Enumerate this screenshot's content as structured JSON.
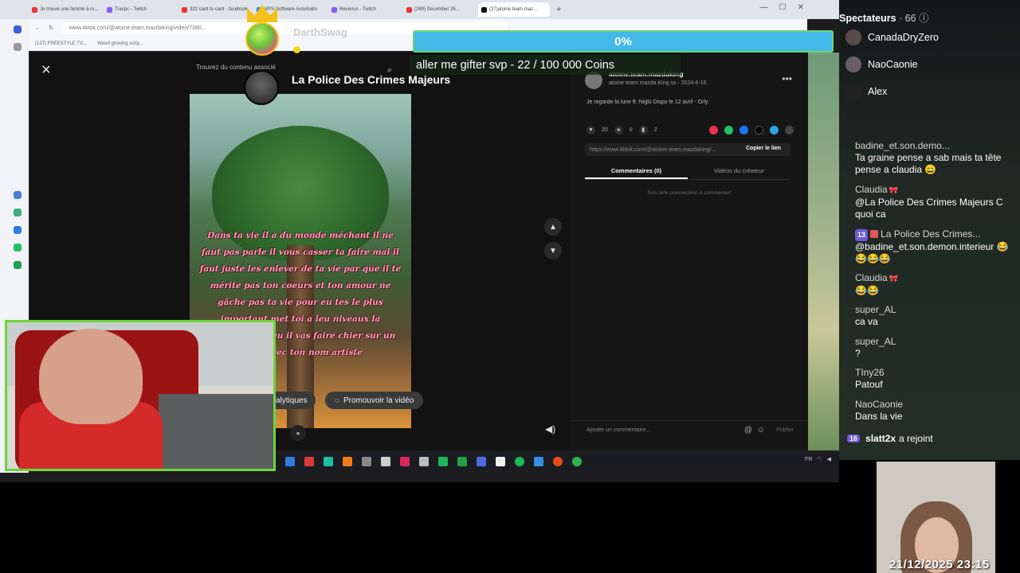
{
  "browser": {
    "tabs": [
      {
        "label": "Je trouve une femme à m..."
      },
      {
        "label": "Tracpc - Twitch"
      },
      {
        "label": "322 card to card - facebook"
      },
      {
        "label": "VPS-Software Automatio"
      },
      {
        "label": "Revenus - Twitch"
      },
      {
        "label": "(269) December 25..."
      },
      {
        "label": "(37)atoine.team.maz..."
      }
    ],
    "new_tab": "+",
    "url": "www.tiktok.com/@atoine.team.mazdaking/video/7380...",
    "bookmarks": [
      "(127) FREESTYLE TV...",
      "Weed growing scrip..."
    ]
  },
  "tiktok": {
    "close_icon": "×",
    "search_overlay": "Trouvez du contenu associé",
    "creator_name": "La Police Des Crimes Majeurs",
    "poem": "Dans ta vie il a du monde méchant il ne faut pas parle il vous casser ta faire mal il faut juste les enlever de ta vie par que il te mérite pas ton coeurs et ton amour ne gâche pas ta vie pour eu tes le plus important met toi a leu niveaux la personne que eu il vas faire chier sur un autre avec ton nom artiste",
    "analytics_label": "alytiques",
    "promote_label": "Promouvoir la vidéo",
    "author": {
      "name": "atoine.team.mazdaking",
      "sub": "atoine team mazda King ss · 2024-6-16"
    },
    "music": "Je regarde la lune ft. Niglo Dispo le 12 avril - Orly",
    "stats": {
      "likes": "20",
      "comments": "0",
      "saves": "2"
    },
    "link": "https://www.tiktok.com/@atoine.team.mazdaking/...",
    "copy_link": "Copier le lien",
    "tabs": [
      "Commentaires (0)",
      "Vidéos du créateur"
    ],
    "empty_comments": "Sois la/le premier(ère) à commenter!",
    "comment_placeholder": "Ajouter un commentaire...",
    "comment_at": "@",
    "comment_emoji": "☺",
    "post_label": "Publier"
  },
  "overlay": {
    "goal_percent": "0%",
    "goal_text": "aller me gifter svp - 22 / 100 000 Coins",
    "alert_user": "DarthSwag"
  },
  "chat": {
    "viewers_label": "Spectateurs",
    "viewers_count": "· 66",
    "viewers": [
      {
        "name": "CanadaDryZero"
      },
      {
        "name": "NaoCaonie"
      },
      {
        "name": "Alex"
      }
    ],
    "messages": [
      {
        "user": "badine_et.son.demo...",
        "text": "Ta graine pense a sab mais ta tête pense a claudia 😄"
      },
      {
        "user": "Claudia",
        "text": "@La Police Des Crimes Majeurs C quoi ca"
      },
      {
        "user": "La Police Des Crimes...",
        "badge": "13",
        "text": "@badine_et.son.demon.interieur 😂😂😂😂"
      },
      {
        "user": "Claudia",
        "text": "😂😂"
      },
      {
        "user": "super_AL",
        "text": "ca va"
      },
      {
        "user": "super_AL",
        "text": "?"
      },
      {
        "user": "TIny26",
        "text": "Patouf"
      },
      {
        "user": "NaoCaonie",
        "text": "Dans la vie"
      }
    ],
    "join": {
      "badge": "16",
      "user": "slatt2x",
      "text": "a rejoint"
    }
  },
  "taskbar": {
    "tray_text": "FR"
  },
  "timestamp": "21/12/2025 23:15"
}
